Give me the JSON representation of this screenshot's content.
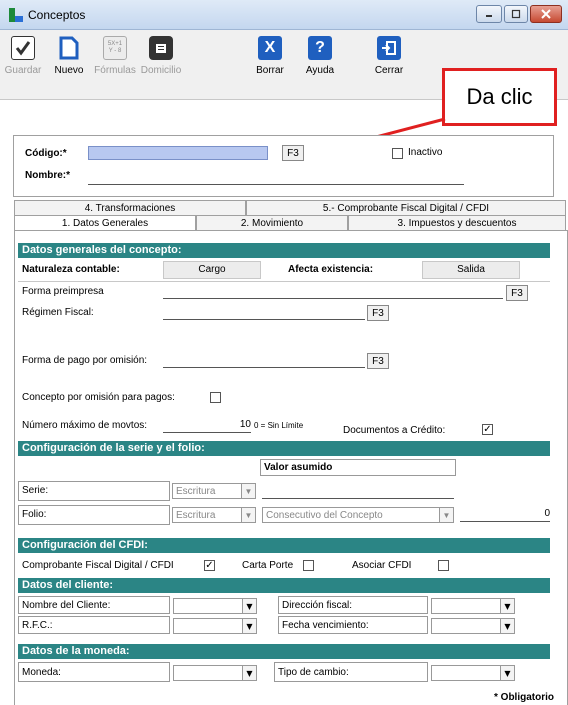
{
  "window": {
    "title": "Conceptos"
  },
  "toolbar": {
    "guardar": "Guardar",
    "nuevo": "Nuevo",
    "formulas": "Fórmulas",
    "formulas_icon_text": "5X+1\nY - 8",
    "domicilio": "Domicilio",
    "borrar": "Borrar",
    "ayuda": "Ayuda",
    "cerrar": "Cerrar"
  },
  "callout": {
    "text": "Da clic"
  },
  "header": {
    "codigo_label": "Código:*",
    "nombre_label": "Nombre:*",
    "f3": "F3",
    "inactivo_label": "Inactivo",
    "codigo_value": "",
    "nombre_value": ""
  },
  "tabs": {
    "row1": [
      "4. Transformaciones",
      "5.- Comprobante Fiscal Digital / CFDI"
    ],
    "row2": [
      "1. Datos Generales",
      "2. Movimiento",
      "3. Impuestos y descuentos"
    ]
  },
  "general": {
    "section_title": "Datos generales del concepto:",
    "naturaleza_label": "Naturaleza contable:",
    "naturaleza_value": "Cargo",
    "afecta_label": "Afecta existencia:",
    "afecta_value": "Salida",
    "forma_preimpresa_label": "Forma preimpresa",
    "regimen_label": "Régimen Fiscal:",
    "forma_pago_label": "Forma de pago por omisión:",
    "concepto_omision_label": "Concepto por omisión para pagos:",
    "num_max_label": "Número máximo de movtos:",
    "num_max_value": "10",
    "num_max_hint": "0 = Sin Límite",
    "doc_credito_label": "Documentos a Crédito:",
    "doc_credito_checked": "✓"
  },
  "serie_folio": {
    "section_title": "Configuración de la serie y el folio:",
    "valor_asumido": "Valor asumido",
    "serie_label": "Serie:",
    "folio_label": "Folio:",
    "escritura": "Escritura",
    "consecutivo": "Consecutivo del Concepto",
    "folio_value": "0"
  },
  "cfdi": {
    "section_title": "Configuración del CFDI:",
    "cfd_label": "Comprobante Fiscal Digital / CFDI",
    "cfd_checked": "✓",
    "carta_porte_label": "Carta Porte",
    "asociar_label": "Asociar CFDI"
  },
  "cliente": {
    "section_title": "Datos del cliente:",
    "nombre_label": "Nombre del Cliente:",
    "rfc_label": "R.F.C.:",
    "direccion_label": "Dirección fiscal:",
    "vencimiento_label": "Fecha vencimiento:"
  },
  "moneda": {
    "section_title": "Datos de la moneda:",
    "moneda_label": "Moneda:",
    "tipo_cambio_label": "Tipo de cambio:"
  },
  "footer": {
    "obligatorio": "* Obligatorio"
  },
  "colors": {
    "section": "#2b8585",
    "callout_red": "#e02020"
  }
}
